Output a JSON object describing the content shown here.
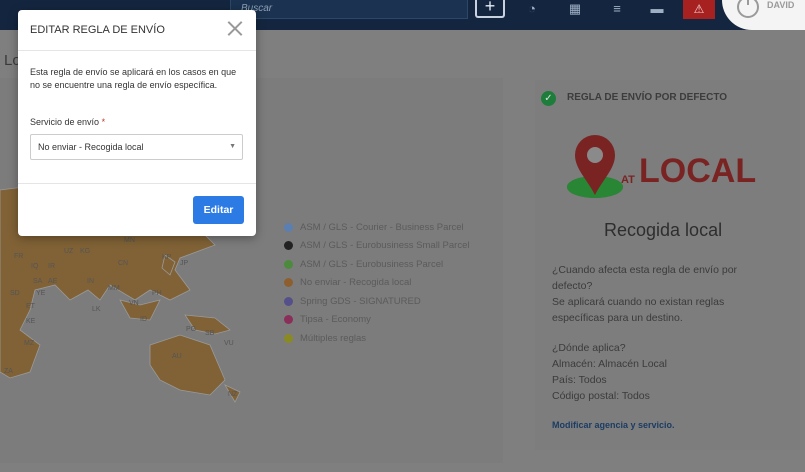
{
  "topbar": {
    "search_placeholder": "Buscar",
    "user_name": "DAVID"
  },
  "page": {
    "title": "Lo"
  },
  "map": {
    "countries": [
      "FR",
      "IQ",
      "IR",
      "UZ",
      "KG",
      "MN",
      "KP",
      "JP",
      "CN",
      "SA",
      "AE",
      "IN",
      "MM",
      "SD",
      "YE",
      "ET",
      "VN",
      "PH",
      "LK",
      "ID",
      "KE",
      "MZ",
      "PG",
      "SB",
      "AU",
      "VU",
      "ZA",
      "NZ"
    ],
    "legend": [
      {
        "label": "ASM / GLS - Courier - Business Parcel",
        "color": "#5b7fb0"
      },
      {
        "label": "ASM / GLS - Eurobusiness Small Parcel",
        "color": "#222222"
      },
      {
        "label": "ASM / GLS - Eurobusiness Parcel",
        "color": "#4c8a3c"
      },
      {
        "label": "No enviar - Recogida local",
        "color": "#8e5f2e"
      },
      {
        "label": "Spring GDS - SIGNATURED",
        "color": "#55508a"
      },
      {
        "label": "Tipsa - Economy",
        "color": "#8a2f5a"
      },
      {
        "label": "Múltiples reglas",
        "color": "#8a8a22"
      }
    ]
  },
  "default_rule": {
    "title": "REGLA DE ENVÍO POR DEFECTO",
    "logo_small": "AT",
    "logo_text": "LOCAL",
    "heading": "Recogida local",
    "q1": "¿Cuando afecta esta regla de envío por defecto?",
    "a1": "Se aplicará cuando no existan reglas específicas para un destino.",
    "q2": "¿Dónde aplica?",
    "warehouse": "Almacén: Almacén Local",
    "country": "País: Todos",
    "postal": "Código postal: Todos",
    "link": "Modificar agencia y servicio."
  },
  "modal": {
    "title": "EDITAR REGLA DE ENVÍO",
    "description": "Esta regla de envío se aplicará en los casos en que no se encuentre una regla de envío específica.",
    "field_label": "Servicio de envío",
    "required_mark": "*",
    "selected_value": "No enviar - Recogida local",
    "submit_label": "Editar"
  },
  "colors": {
    "accent": "#2c7be5",
    "topbar": "#14263f",
    "alert": "#a82121",
    "logo_red": "#c23b3b",
    "logo_green": "#2f9a3e"
  }
}
